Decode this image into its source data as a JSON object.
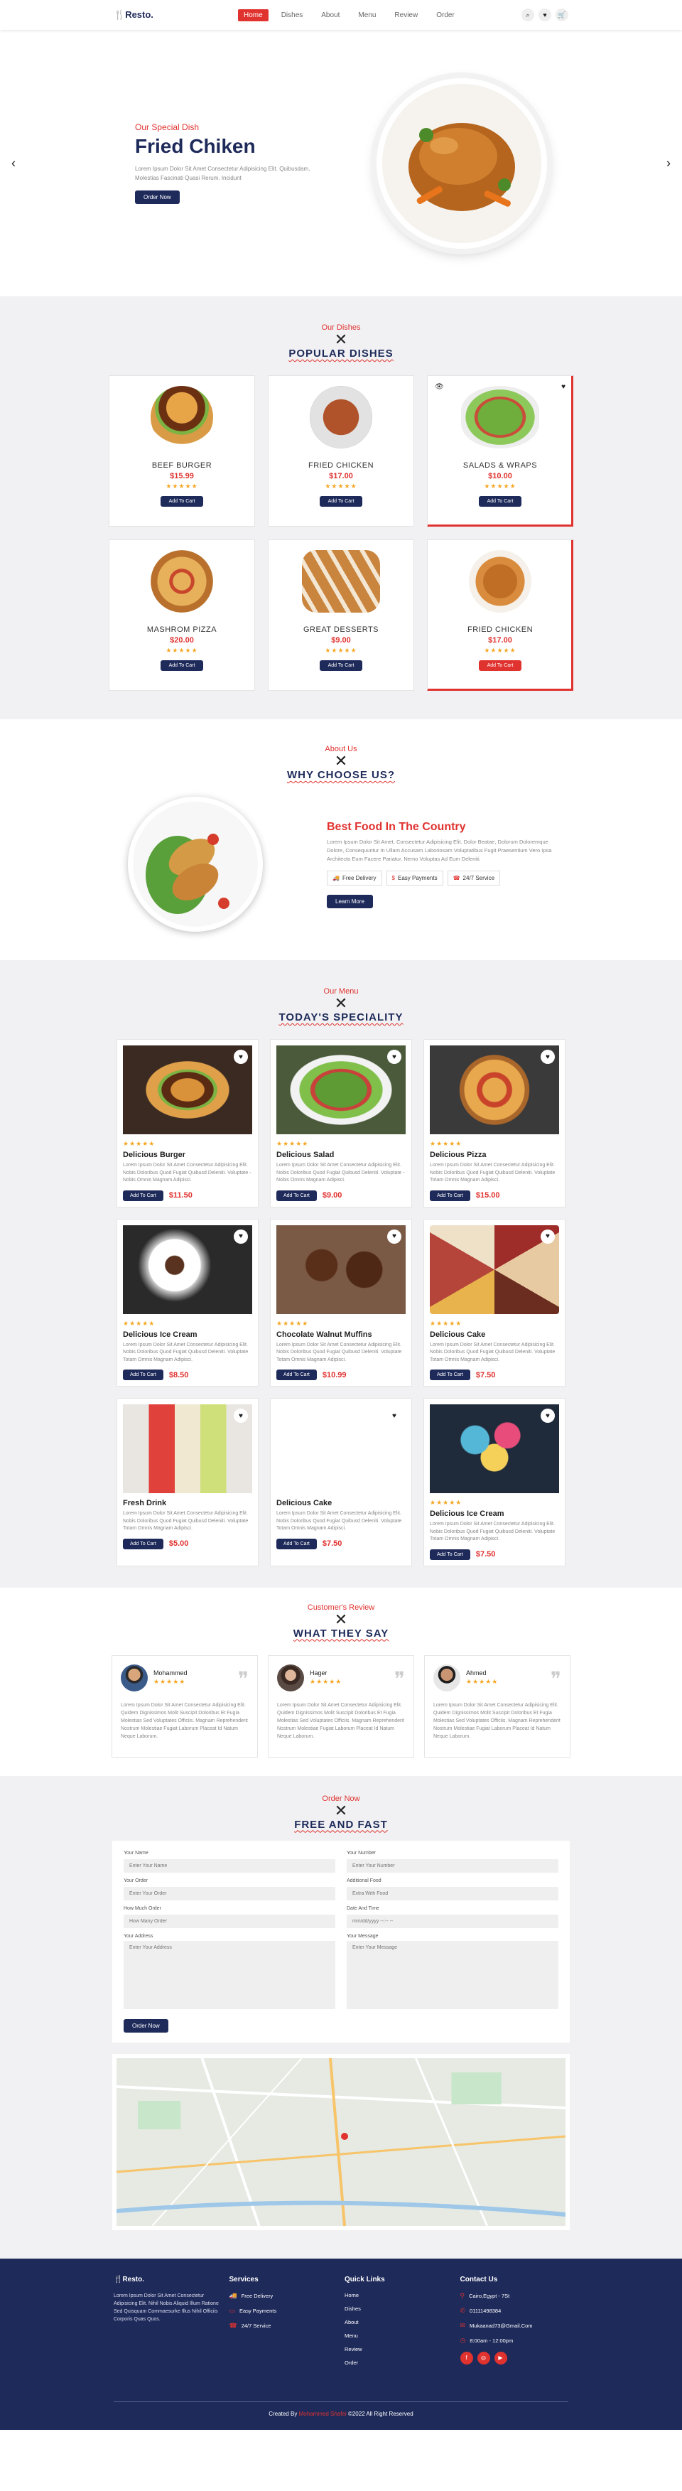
{
  "brand": {
    "mark": "🍴",
    "name": "Resto."
  },
  "nav": {
    "items": [
      "Home",
      "Dishes",
      "About",
      "Menu",
      "Review",
      "Order"
    ],
    "active": "Home"
  },
  "hero": {
    "subtitle": "Our Special Dish",
    "title": "Fried Chiken",
    "text": "Lorem Ipsum Dolor Sit Amet Consectetur Adipisicing Elit. Quibusdam, Molestias Fascinati Quasi Rerum. Incidunt",
    "button": "Order Now"
  },
  "dishes": {
    "subtitle": "Our Dishes",
    "title": "POPULAR DISHES",
    "cart_label": "Add To Cart",
    "stars": "★★★★★",
    "items": [
      {
        "name": "BEEF BURGER",
        "price": "$15.99"
      },
      {
        "name": "FRIED CHICKEN",
        "price": "$17.00"
      },
      {
        "name": "SALADS & WRAPS",
        "price": "$10.00"
      },
      {
        "name": "MASHROM PIZZA",
        "price": "$20.00"
      },
      {
        "name": "GREAT DESSERTS",
        "price": "$9.00"
      },
      {
        "name": "FRIED CHICKEN",
        "price": "$17.00"
      }
    ]
  },
  "about": {
    "subtitle": "About Us",
    "title": "WHY CHOOSE US?",
    "heading": "Best Food In The Country",
    "text": "Lorem Ipsum Dolor Sit Amet, Consectetur Adipisicing Elit. Dolor Beatae, Dolorum Doloremque Dolore, Consequuntur In Ullam Accusam Laboriosam Voluptatibus Fugit Praesentium Vero Ipsa Architecto Eum Facere Pariatur. Nemo Voluptas Ad Eum Deleniti.",
    "features": [
      "Free Delivery",
      "Easy Payments",
      "24/7 Service"
    ],
    "button": "Learn More"
  },
  "menu": {
    "subtitle": "Our Menu",
    "title": "TODAY'S SPECIALITY",
    "cart_label": "Add To Cart",
    "stars": "★★★★★",
    "items": [
      {
        "name": "Delicious Burger",
        "price": "$11.50",
        "desc": "Lorem Ipsum Dolor Sit Amet Consectetur Adipisicing Elit. Nobis Doloribus Quod Fugiat Quibusd Deleniti. Voluptate - Nobis Omnis Magnam Adipisci."
      },
      {
        "name": "Delicious Salad",
        "price": "$9.00",
        "desc": "Lorem Ipsum Dolor Sit Amet Consectetur Adipisicing Elit. Nobis Doloribus Quod Fugiat Quibusd Deleniti. Voluptate - Nobis Omnis Magnam Adipisci."
      },
      {
        "name": "Delicious Pizza",
        "price": "$15.00",
        "desc": "Lorem Ipsum Dolor Sit Amet Consectetur Adipisicing Elit. Nobis Doloribus Quod Fugiat Quibusd Deleniti. Voluptate Totam Omnis Magnam Adipisci."
      },
      {
        "name": "Delicious Ice Cream",
        "price": "$8.50",
        "desc": "Lorem Ipsum Dolor Sit Amet Consectetur Adipisicing Elit. Nobis Doloribus Quod Fugiat Quibusd Deleniti. Voluptate Totam Omnis Magnam Adipisci."
      },
      {
        "name": "Chocolate Walnut Muffins",
        "price": "$10.99",
        "desc": "Lorem Ipsum Dolor Sit Amet Consectetur Adipisicing Elit. Nobis Doloribus Quod Fugiat Quibusd Deleniti. Voluptate Totam Omnis Magnam Adipisci."
      },
      {
        "name": "Delicious Cake",
        "price": "$7.50",
        "desc": "Lorem Ipsum Dolor Sit Amet Consectetur Adipisicing Elit. Nobis Doloribus Quod Fugiat Quibusd Deleniti. Voluptate Totam Omnis Magnam Adipisci."
      },
      {
        "name": "Fresh Drink",
        "price": "$5.00",
        "desc": "Lorem Ipsum Dolor Sit Amet Consectetur Adipisicing Elit. Nobis Doloribus Quod Fugiat Quibusd Deleniti. Voluptate Totam Omnis Magnam Adipisci."
      },
      {
        "name": "Delicious Cake",
        "price": "$7.50",
        "desc": "Lorem Ipsum Dolor Sit Amet Consectetur Adipisicing Elit. Nobis Doloribus Quod Fugiat Quibusd Deleniti. Voluptate Totam Omnis Magnam Adipisci."
      },
      {
        "name": "Delicious Ice Cream",
        "price": "$7.50",
        "desc": "Lorem Ipsum Dolor Sit Amet Consectetur Adipisicing Elit. Nobis Doloribus Quod Fugiat Quibusd Deleniti. Voluptate Totam Omnis Magnam Adipisci."
      }
    ]
  },
  "reviews": {
    "subtitle": "Customer's Review",
    "title": "WHAT THEY SAY",
    "stars": "★★★★★",
    "items": [
      {
        "name": "Mohammed",
        "text": "Lorem Ipsum Dolor Sit Amet Consectetur Adipisicing Elit. Quidem Dignissimos Molit Suscipit Doloribus Et Fugia Molestias Sed Voluptates Officiis. Magnam Reprehenderit Nostrum Molestiae Fugiat Laborum Placeat Id Natum Neque Laborum."
      },
      {
        "name": "Hager",
        "text": "Lorem Ipsum Dolor Sit Amet Consectetur Adipisicing Elit. Quidem Dignissimos Molit Suscipit Doloribus Et Fugia Molestias Sed Voluptates Officiis. Magnam Reprehenderit Nostrum Molestiae Fugiat Laborum Placeat Id Natum Neque Laborum."
      },
      {
        "name": "Ahmed",
        "text": "Lorem Ipsum Dolor Sit Amet Consectetur Adipisicing Elit. Quidem Dignissimos Molit Suscipit Doloribus Et Fugia Molestias Sed Voluptates Officiis. Magnam Reprehenderit Nostrum Molestiae Fugiat Laborum Placeat Id Natum Neque Laborum."
      }
    ]
  },
  "order": {
    "subtitle": "Order Now",
    "title": "FREE AND FAST",
    "fields": {
      "name": {
        "label": "Your Name",
        "placeholder": "Enter Your Name"
      },
      "number": {
        "label": "Your Number",
        "placeholder": "Enter Your Number"
      },
      "order": {
        "label": "Your Order",
        "placeholder": "Enter Your Order"
      },
      "food": {
        "label": "Additional Food",
        "placeholder": "Extra With Food"
      },
      "count": {
        "label": "How Much Order",
        "placeholder": "How Many Order"
      },
      "date": {
        "label": "Date And Time",
        "placeholder": "mm/dd/yyyy --:-- --"
      },
      "address": {
        "label": "Your Address",
        "placeholder": "Enter Your Address"
      },
      "message": {
        "label": "Your Message",
        "placeholder": "Enter Your Message"
      }
    },
    "button": "Order Now"
  },
  "footer": {
    "about": "Lorem Ipsum Dolor Sit Amet Consectetur Adipisicing Elit. Nihil Nobis Aliquid Illum Ratione Sed Quisquam Commaesurke Illus Nihil Officiis Corporis Quas Quos.",
    "services": {
      "title": "Services",
      "items": [
        "Free Delivery",
        "Easy Payments",
        "24/7 Service"
      ]
    },
    "links": {
      "title": "Quick Links",
      "items": [
        "Home",
        "Dishes",
        "About",
        "Menu",
        "Review",
        "Order"
      ]
    },
    "contact": {
      "title": "Contact Us",
      "items": [
        "Cairo,Egypt - 7St",
        "01111498384",
        "Mukaanad73@Gmail.Com",
        "8:00am - 12:00pm"
      ]
    },
    "copyright": {
      "prefix": "Created By",
      "author": "Mohammed Shafei",
      "suffix": "©2022 All Right Reserved"
    }
  }
}
